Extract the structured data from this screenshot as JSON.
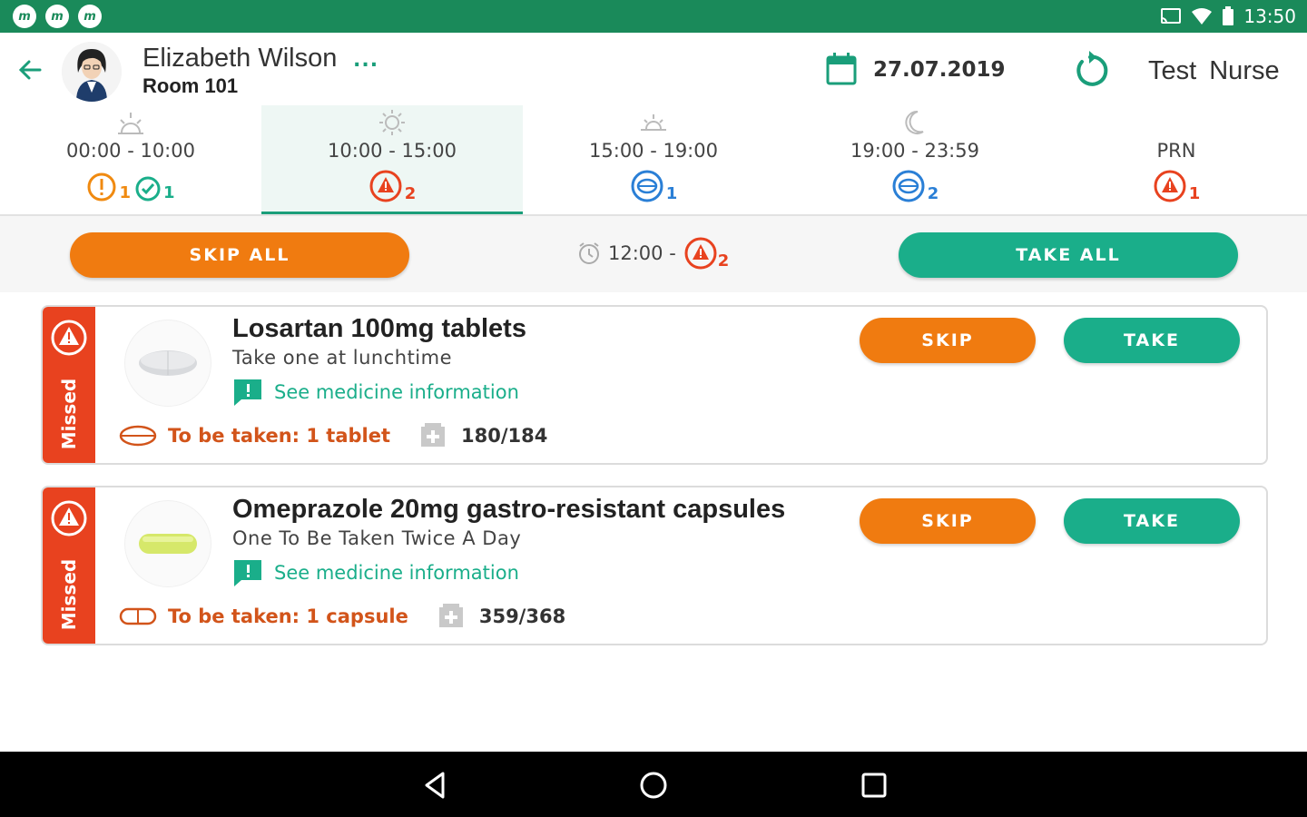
{
  "status_bar": {
    "app_icons": [
      "m",
      "m",
      "m"
    ],
    "time": "13:50",
    "icons": [
      "cast-icon",
      "wifi-icon",
      "battery-icon"
    ]
  },
  "header": {
    "patient_name": "Elizabeth Wilson",
    "more": "...",
    "room": "Room 101",
    "date": "27.07.2019",
    "user": "Test Nurse"
  },
  "tabs": [
    {
      "label": "00:00 - 10:00",
      "icon": "sunrise-icon",
      "badges": [
        {
          "type": "warning",
          "count": "1"
        },
        {
          "type": "taken",
          "count": "1"
        }
      ]
    },
    {
      "label": "10:00 - 15:00",
      "icon": "sun-icon",
      "badges": [
        {
          "type": "missed",
          "count": "2"
        }
      ],
      "active": true
    },
    {
      "label": "15:00 - 19:00",
      "icon": "sunset-icon",
      "badges": [
        {
          "type": "pending",
          "count": "1"
        }
      ]
    },
    {
      "label": "19:00 - 23:59",
      "icon": "moon-icon",
      "badges": [
        {
          "type": "pending",
          "count": "2"
        }
      ]
    },
    {
      "label": "PRN",
      "icon": "",
      "badges": [
        {
          "type": "missed",
          "count": "1"
        }
      ]
    }
  ],
  "action_bar": {
    "skip_all": "SKIP ALL",
    "take_all": "TAKE ALL",
    "slot_time": "12:00 -",
    "slot_count": "2"
  },
  "medications": [
    {
      "status": "Missed",
      "name": "Losartan 100mg tablets",
      "instructions": "Take one at lunchtime",
      "info_link": "See medicine information",
      "dose": "To be taken: 1 tablet",
      "stock": "180/184",
      "skip": "SKIP",
      "take": "TAKE"
    },
    {
      "status": "Missed",
      "name": "Omeprazole 20mg gastro-resistant capsules",
      "instructions": "One To Be Taken Twice A Day",
      "info_link": "See medicine information",
      "dose": "To be taken: 1 capsule",
      "stock": "359/368",
      "skip": "SKIP",
      "take": "TAKE"
    }
  ],
  "colors": {
    "brand": "#1a8a5a",
    "accent": "#1aae8a",
    "orange": "#f07b10",
    "missed": "#e8421f",
    "pending": "#2a7fd6"
  }
}
